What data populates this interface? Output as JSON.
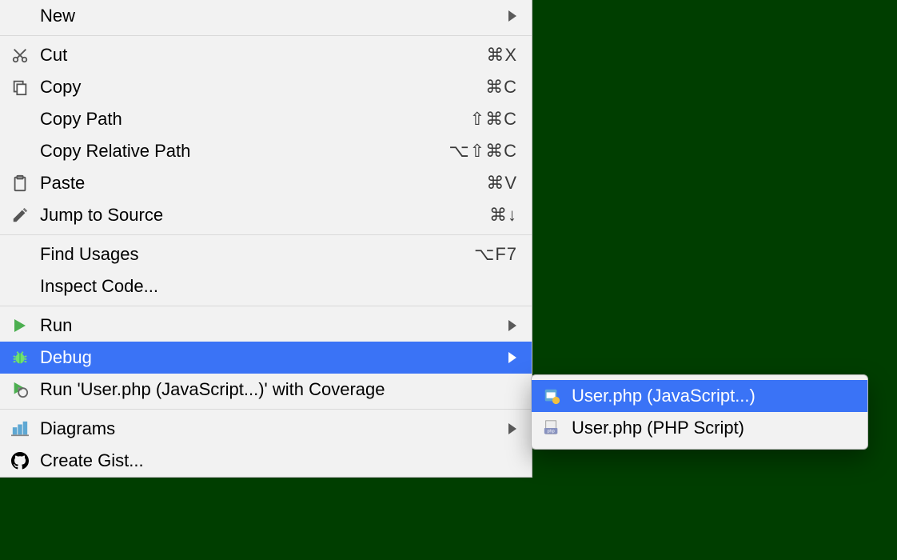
{
  "context_menu": {
    "groups": [
      [
        {
          "id": "new",
          "label": "New",
          "submenu": true
        }
      ],
      [
        {
          "id": "cut",
          "label": "Cut",
          "shortcut": "⌘X",
          "icon": "cut"
        },
        {
          "id": "copy",
          "label": "Copy",
          "shortcut": "⌘C",
          "icon": "copy"
        },
        {
          "id": "copy-path",
          "label": "Copy Path",
          "shortcut": "⇧⌘C"
        },
        {
          "id": "copy-relative-path",
          "label": "Copy Relative Path",
          "shortcut": "⌥⇧⌘C"
        },
        {
          "id": "paste",
          "label": "Paste",
          "shortcut": "⌘V",
          "icon": "paste"
        },
        {
          "id": "jump-to-source",
          "label": "Jump to Source",
          "shortcut": "⌘↓",
          "icon": "edit"
        }
      ],
      [
        {
          "id": "find-usages",
          "label": "Find Usages",
          "shortcut": "⌥F7"
        },
        {
          "id": "inspect-code",
          "label": "Inspect Code..."
        }
      ],
      [
        {
          "id": "run",
          "label": "Run",
          "submenu": true,
          "icon": "run"
        },
        {
          "id": "debug",
          "label": "Debug",
          "submenu": true,
          "icon": "debug",
          "selected": true
        },
        {
          "id": "run-coverage",
          "label": "Run 'User.php (JavaScript...)' with Coverage",
          "icon": "coverage"
        }
      ],
      [
        {
          "id": "diagrams",
          "label": "Diagrams",
          "submenu": true,
          "icon": "diagrams"
        },
        {
          "id": "create-gist",
          "label": "Create Gist...",
          "icon": "github"
        }
      ]
    ]
  },
  "submenu": {
    "items": [
      {
        "id": "debug-js",
        "label": "User.php (JavaScript...)",
        "icon": "js-debug",
        "selected": true
      },
      {
        "id": "debug-php",
        "label": "User.php (PHP Script)",
        "icon": "php-file"
      }
    ]
  }
}
